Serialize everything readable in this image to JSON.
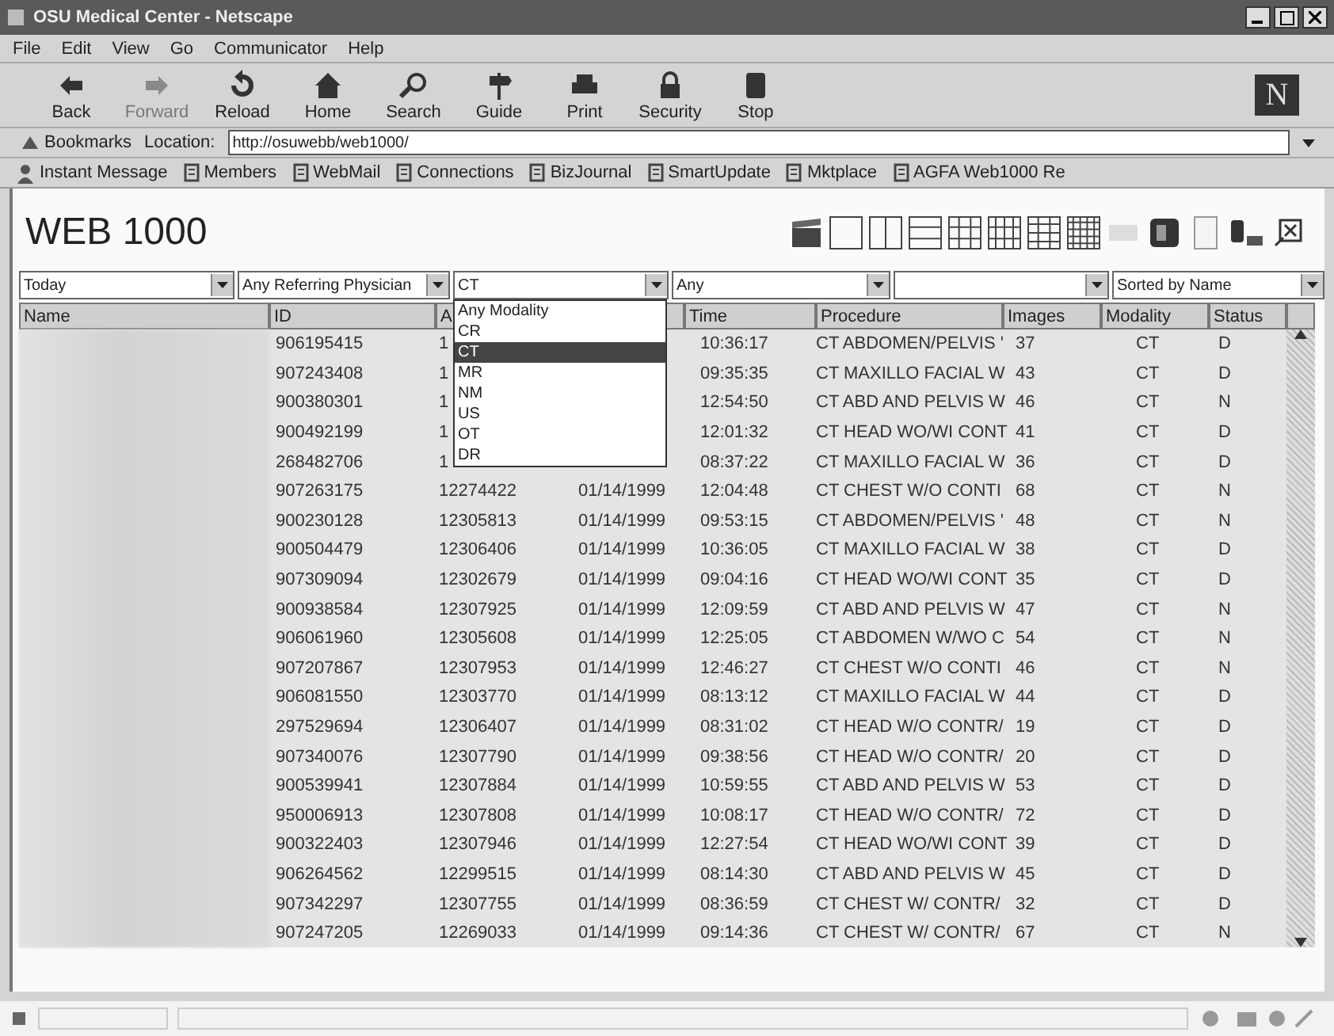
{
  "window": {
    "title": "OSU Medical Center - Netscape"
  },
  "menu": [
    "File",
    "Edit",
    "View",
    "Go",
    "Communicator",
    "Help"
  ],
  "toolbar": [
    {
      "kind": "back",
      "label": "Back",
      "disabled": false
    },
    {
      "kind": "forward",
      "label": "Forward",
      "disabled": true
    },
    {
      "kind": "reload",
      "label": "Reload",
      "disabled": false
    },
    {
      "kind": "home",
      "label": "Home",
      "disabled": false
    },
    {
      "kind": "search",
      "label": "Search",
      "disabled": false
    },
    {
      "kind": "guide",
      "label": "Guide",
      "disabled": false
    },
    {
      "kind": "print",
      "label": "Print",
      "disabled": false
    },
    {
      "kind": "security",
      "label": "Security",
      "disabled": false
    },
    {
      "kind": "stop",
      "label": "Stop",
      "disabled": false
    }
  ],
  "brand_mark": "N",
  "location_bar": {
    "bookmarks": "Bookmarks",
    "label": "Location:",
    "url": "http://osuwebb/web1000/"
  },
  "personal_toolbar": [
    {
      "kind": "person",
      "label": "Instant Message"
    },
    {
      "kind": "bookmark",
      "label": "Members"
    },
    {
      "kind": "bookmark",
      "label": "WebMail"
    },
    {
      "kind": "bookmark",
      "label": "Connections"
    },
    {
      "kind": "bookmark",
      "label": "BizJournal"
    },
    {
      "kind": "bookmark",
      "label": "SmartUpdate"
    },
    {
      "kind": "bookmark",
      "label": "Mktplace"
    },
    {
      "kind": "bookmark",
      "label": "AGFA Web1000 Re"
    }
  ],
  "app": {
    "title": "WEB 1000",
    "filters": [
      {
        "kind": "select",
        "value": "Today"
      },
      {
        "kind": "select",
        "value": "Any Referring Physician"
      },
      {
        "kind": "select",
        "value": "CT"
      },
      {
        "kind": "select",
        "value": "Any"
      },
      {
        "kind": "select"
      },
      {
        "kind": "select",
        "value": "Sorted by Name"
      }
    ],
    "modality_dropdown": [
      {
        "label": "Any Modality",
        "selected": false
      },
      {
        "label": "CR",
        "selected": false
      },
      {
        "label": "CT",
        "selected": true
      },
      {
        "label": "MR",
        "selected": false
      },
      {
        "label": "NM",
        "selected": false
      },
      {
        "label": "US",
        "selected": false
      },
      {
        "label": "OT",
        "selected": false
      },
      {
        "label": "DR",
        "selected": false
      }
    ],
    "columns": [
      "Name",
      "ID",
      "A",
      "",
      "Time",
      "Procedure",
      "Images",
      "Modality",
      "Status"
    ],
    "rows": [
      {
        "id": "906195415",
        "accession": "1",
        "time": "10:36:17",
        "procedure": "CT ABDOMEN/PELVIS '",
        "images": "37",
        "modality": "CT",
        "status": "D"
      },
      {
        "id": "907243408",
        "accession": "1",
        "time": "09:35:35",
        "procedure": "CT MAXILLO FACIAL W",
        "images": "43",
        "modality": "CT",
        "status": "D"
      },
      {
        "id": "900380301",
        "accession": "1",
        "time": "12:54:50",
        "procedure": "CT ABD AND PELVIS W",
        "images": "46",
        "modality": "CT",
        "status": "N"
      },
      {
        "id": "900492199",
        "accession": "1",
        "time": "12:01:32",
        "procedure": "CT HEAD WO/WI CONT",
        "images": "41",
        "modality": "CT",
        "status": "D"
      },
      {
        "id": "268482706",
        "accession": "1",
        "time": "08:37:22",
        "procedure": "CT MAXILLO FACIAL W",
        "images": "36",
        "modality": "CT",
        "status": "D"
      },
      {
        "id": "907263175",
        "accession": "12274422",
        "date": "01/14/1999",
        "time": "12:04:48",
        "procedure": "CT CHEST W/O CONTI",
        "images": "68",
        "modality": "CT",
        "status": "N"
      },
      {
        "id": "900230128",
        "accession": "12305813",
        "date": "01/14/1999",
        "time": "09:53:15",
        "procedure": "CT ABDOMEN/PELVIS '",
        "images": "48",
        "modality": "CT",
        "status": "N"
      },
      {
        "id": "900504479",
        "accession": "12306406",
        "date": "01/14/1999",
        "time": "10:36:05",
        "procedure": "CT MAXILLO FACIAL W",
        "images": "38",
        "modality": "CT",
        "status": "D"
      },
      {
        "id": "907309094",
        "accession": "12302679",
        "date": "01/14/1999",
        "time": "09:04:16",
        "procedure": "CT HEAD WO/WI CONT",
        "images": "35",
        "modality": "CT",
        "status": "D"
      },
      {
        "id": "900938584",
        "accession": "12307925",
        "date": "01/14/1999",
        "time": "12:09:59",
        "procedure": "CT ABD AND PELVIS W",
        "images": "47",
        "modality": "CT",
        "status": "N"
      },
      {
        "id": "906061960",
        "accession": "12305608",
        "date": "01/14/1999",
        "time": "12:25:05",
        "procedure": "CT ABDOMEN W/WO C",
        "images": "54",
        "modality": "CT",
        "status": "N"
      },
      {
        "id": "907207867",
        "accession": "12307953",
        "date": "01/14/1999",
        "time": "12:46:27",
        "procedure": "CT CHEST W/O CONTI",
        "images": "46",
        "modality": "CT",
        "status": "N"
      },
      {
        "id": "906081550",
        "accession": "12303770",
        "date": "01/14/1999",
        "time": "08:13:12",
        "procedure": "CT MAXILLO FACIAL W",
        "images": "44",
        "modality": "CT",
        "status": "D"
      },
      {
        "id": "297529694",
        "accession": "12306407",
        "date": "01/14/1999",
        "time": "08:31:02",
        "procedure": "CT HEAD W/O CONTR/",
        "images": "19",
        "modality": "CT",
        "status": "D"
      },
      {
        "id": "907340076",
        "accession": "12307790",
        "date": "01/14/1999",
        "time": "09:38:56",
        "procedure": "CT HEAD W/O CONTR/",
        "images": "20",
        "modality": "CT",
        "status": "D"
      },
      {
        "id": "900539941",
        "accession": "12307884",
        "date": "01/14/1999",
        "time": "10:59:55",
        "procedure": "CT ABD AND PELVIS W",
        "images": "53",
        "modality": "CT",
        "status": "D"
      },
      {
        "id": "950006913",
        "accession": "12307808",
        "date": "01/14/1999",
        "time": "10:08:17",
        "procedure": "CT HEAD W/O CONTR/",
        "images": "72",
        "modality": "CT",
        "status": "D"
      },
      {
        "id": "900322403",
        "accession": "12307946",
        "date": "01/14/1999",
        "time": "12:27:54",
        "procedure": "CT HEAD WO/WI CONT",
        "images": "39",
        "modality": "CT",
        "status": "D"
      },
      {
        "id": "906264562",
        "accession": "12299515",
        "date": "01/14/1999",
        "time": "08:14:30",
        "procedure": "CT ABD AND PELVIS W",
        "images": "45",
        "modality": "CT",
        "status": "D"
      },
      {
        "id": "907342297",
        "accession": "12307755",
        "date": "01/14/1999",
        "time": "08:36:59",
        "procedure": "CT CHEST W/ CONTR/",
        "images": "32",
        "modality": "CT",
        "status": "D"
      },
      {
        "id": "907247205",
        "accession": "12269033",
        "date": "01/14/1999",
        "time": "09:14:36",
        "procedure": "CT CHEST W/ CONTR/",
        "images": "67",
        "modality": "CT",
        "status": "N"
      }
    ]
  }
}
